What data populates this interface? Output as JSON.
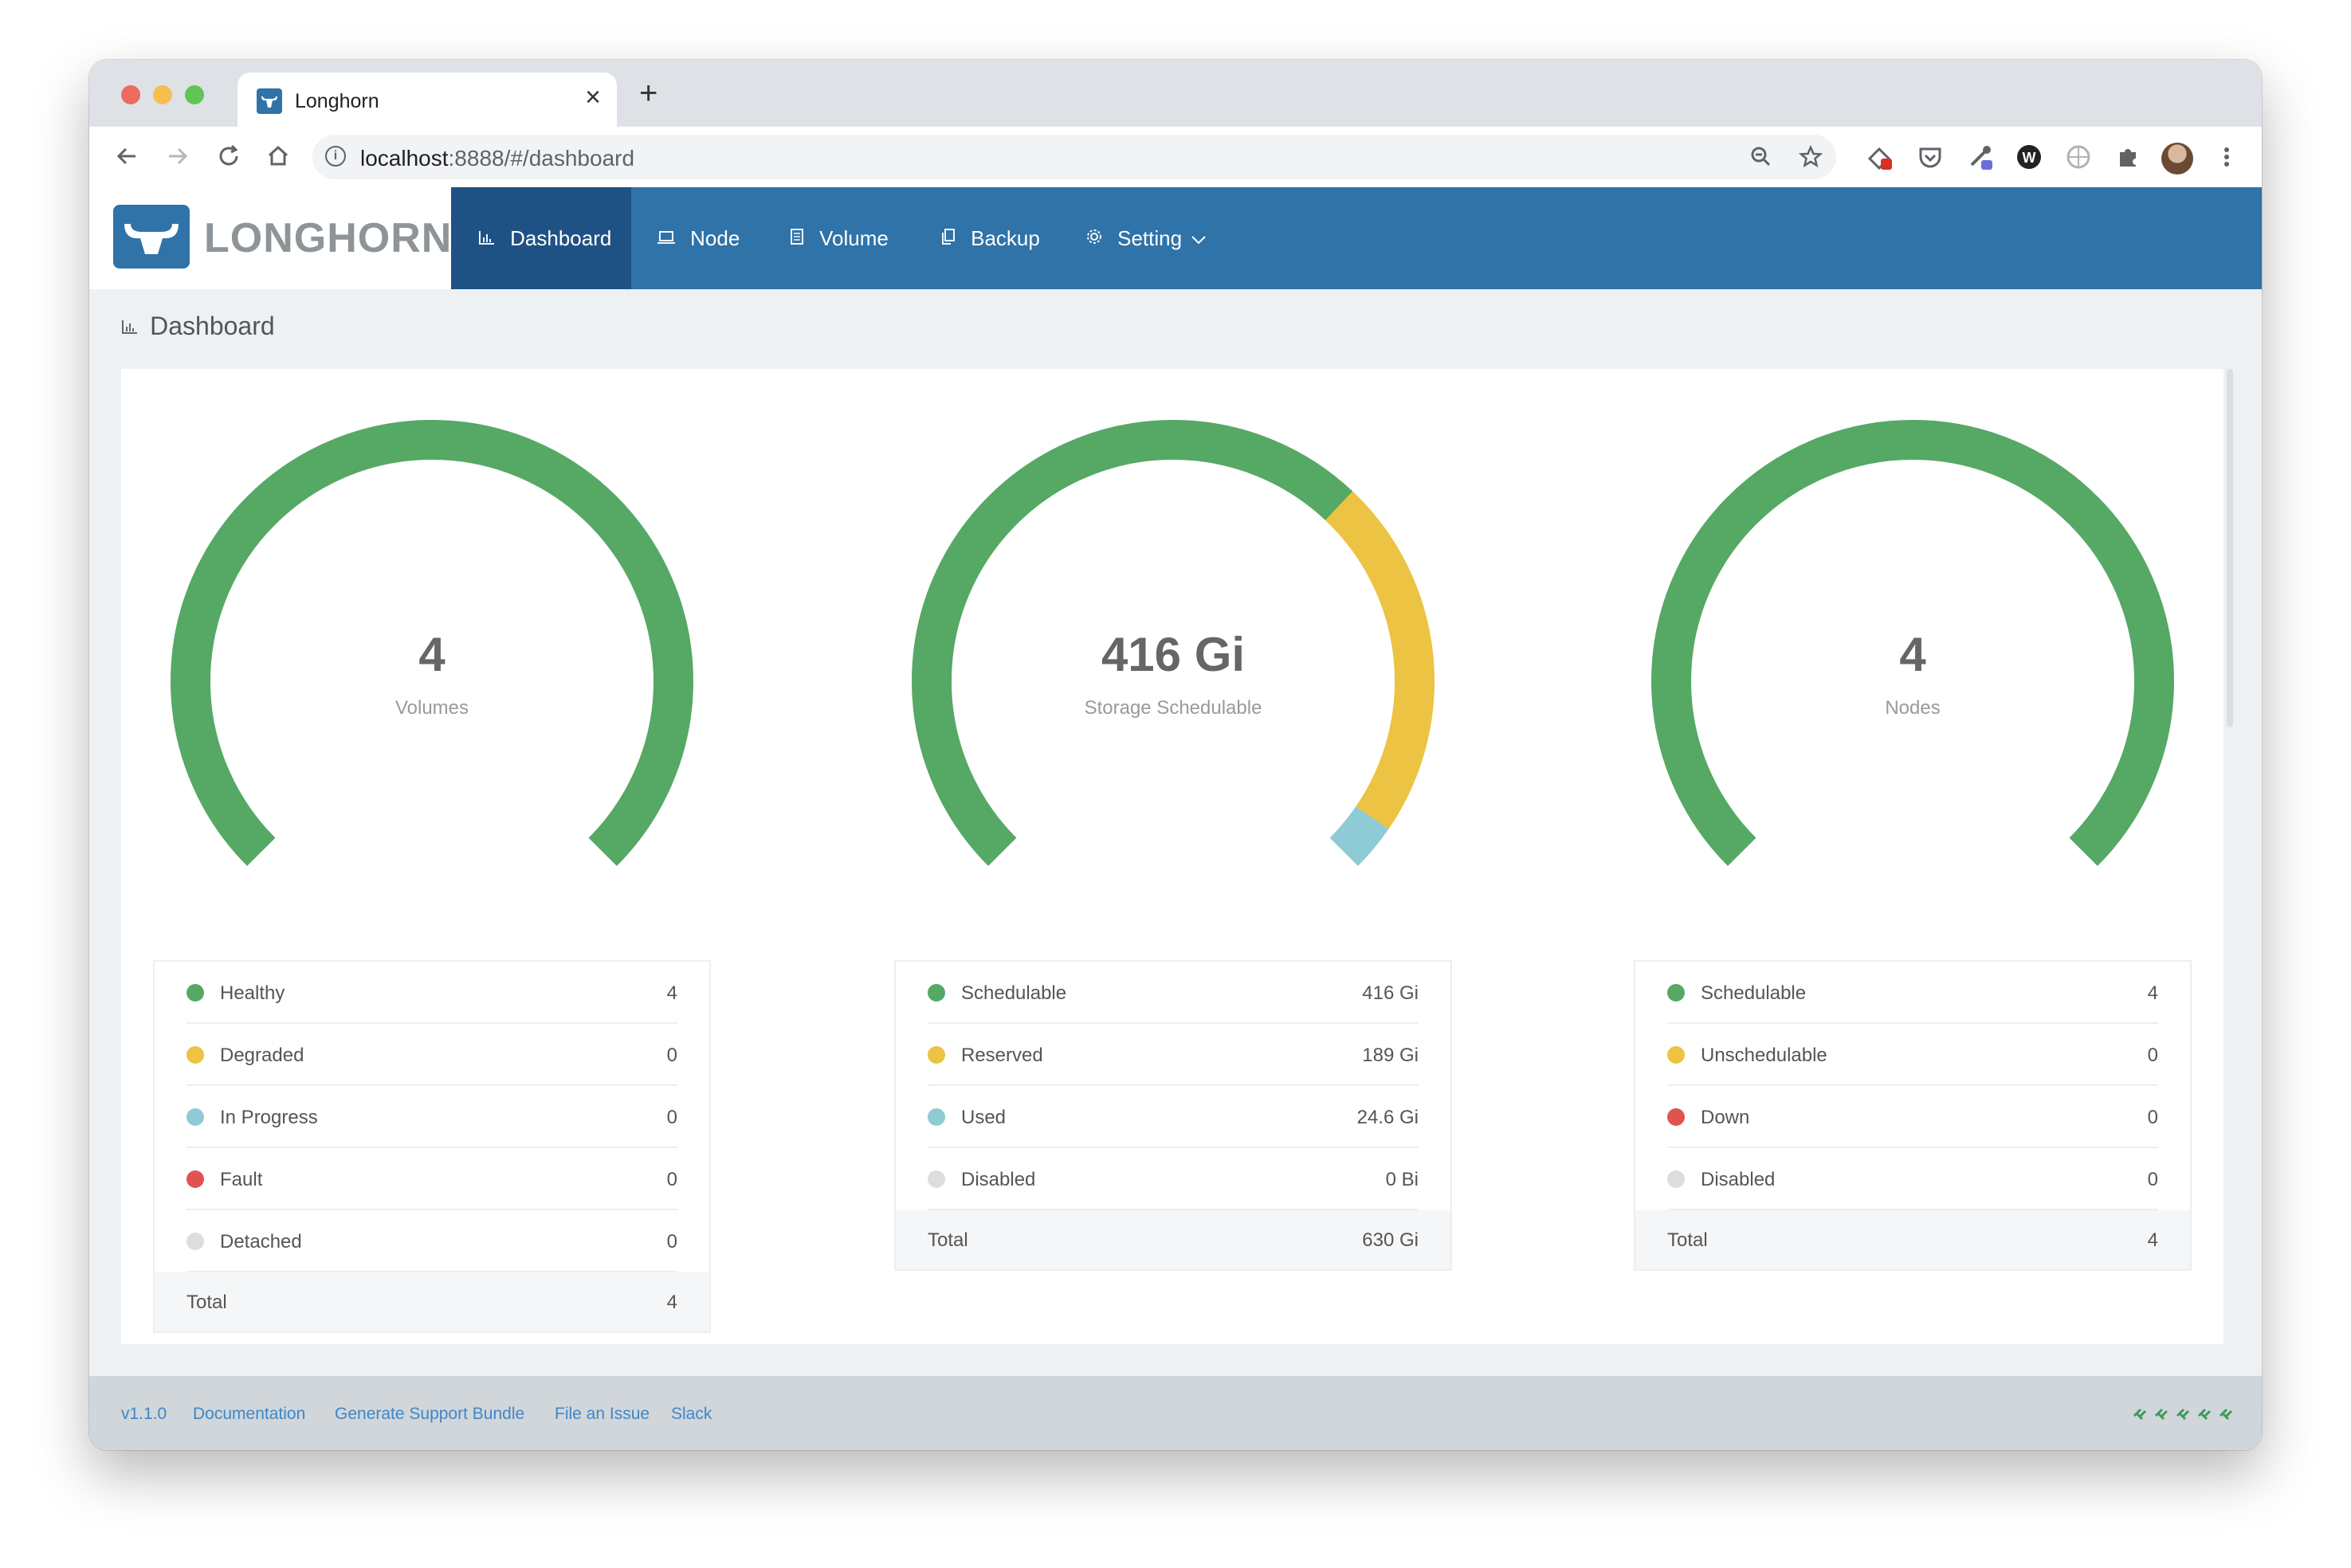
{
  "browser": {
    "tab_title": "Longhorn",
    "new_tab_glyph": "+",
    "close_glyph": "×",
    "url_host": "localhost",
    "url_rest": ":8888/#/dashboard"
  },
  "brand": {
    "name": "LONGHORN"
  },
  "nav": {
    "items": [
      {
        "label": "Dashboard",
        "icon": "chart-icon"
      },
      {
        "label": "Node",
        "icon": "laptop-icon"
      },
      {
        "label": "Volume",
        "icon": "volume-icon"
      },
      {
        "label": "Backup",
        "icon": "copy-icon"
      },
      {
        "label": "Setting",
        "icon": "gear-icon"
      }
    ],
    "active": "Dashboard"
  },
  "page": {
    "title": "Dashboard"
  },
  "colors": {
    "green": "#56a865",
    "yellow": "#ecc342",
    "cyan": "#8fcbd4",
    "red": "#e0544f",
    "gray": "#dddddd",
    "header_blue": "#2f73a8",
    "active_blue": "#1f5284"
  },
  "gauges": [
    {
      "value": "4",
      "label": "Volumes",
      "segments": [
        {
          "name": "Healthy",
          "value": 4,
          "color": "#56a865"
        },
        {
          "name": "Degraded",
          "value": 0,
          "color": "#ecc342"
        },
        {
          "name": "In Progress",
          "value": 0,
          "color": "#8fcbd4"
        },
        {
          "name": "Fault",
          "value": 0,
          "color": "#e0544f"
        },
        {
          "name": "Detached",
          "value": 0,
          "color": "#dddddd"
        }
      ],
      "rows": [
        {
          "label": "Healthy",
          "value": "4",
          "color": "#56a865"
        },
        {
          "label": "Degraded",
          "value": "0",
          "color": "#ecc342"
        },
        {
          "label": "In Progress",
          "value": "0",
          "color": "#8fcbd4"
        },
        {
          "label": "Fault",
          "value": "0",
          "color": "#e0544f"
        },
        {
          "label": "Detached",
          "value": "0",
          "color": "#dddddd"
        }
      ],
      "total": {
        "label": "Total",
        "value": "4"
      }
    },
    {
      "value": "416 Gi",
      "label": "Storage Schedulable",
      "segments": [
        {
          "name": "Schedulable",
          "value": 416,
          "color": "#56a865"
        },
        {
          "name": "Reserved",
          "value": 189,
          "color": "#ecc342"
        },
        {
          "name": "Used",
          "value": 24.6,
          "color": "#8fcbd4"
        },
        {
          "name": "Disabled",
          "value": 0,
          "color": "#dddddd"
        }
      ],
      "rows": [
        {
          "label": "Schedulable",
          "value": "416 Gi",
          "color": "#56a865"
        },
        {
          "label": "Reserved",
          "value": "189 Gi",
          "color": "#ecc342"
        },
        {
          "label": "Used",
          "value": "24.6 Gi",
          "color": "#8fcbd4"
        },
        {
          "label": "Disabled",
          "value": "0 Bi",
          "color": "#dddddd"
        }
      ],
      "total": {
        "label": "Total",
        "value": "630 Gi"
      }
    },
    {
      "value": "4",
      "label": "Nodes",
      "segments": [
        {
          "name": "Schedulable",
          "value": 4,
          "color": "#56a865"
        },
        {
          "name": "Unschedulable",
          "value": 0,
          "color": "#ecc342"
        },
        {
          "name": "Down",
          "value": 0,
          "color": "#e0544f"
        },
        {
          "name": "Disabled",
          "value": 0,
          "color": "#dddddd"
        }
      ],
      "rows": [
        {
          "label": "Schedulable",
          "value": "4",
          "color": "#56a865"
        },
        {
          "label": "Unschedulable",
          "value": "0",
          "color": "#ecc342"
        },
        {
          "label": "Down",
          "value": "0",
          "color": "#e0544f"
        },
        {
          "label": "Disabled",
          "value": "0",
          "color": "#dddddd"
        }
      ],
      "total": {
        "label": "Total",
        "value": "4"
      }
    }
  ],
  "footer": {
    "version": "v1.1.0",
    "links": [
      "Documentation",
      "Generate Support Bundle",
      "File an Issue",
      "Slack"
    ],
    "status_glyph": "🔗🔗🔗🔗🔗"
  }
}
